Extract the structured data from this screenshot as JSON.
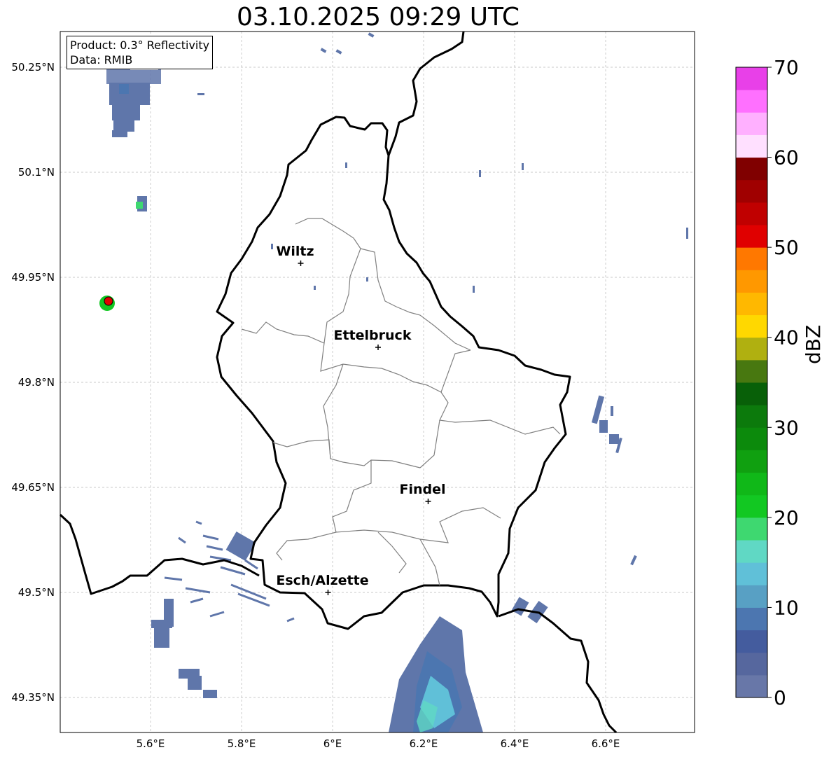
{
  "title": "03.10.2025 09:29 UTC",
  "info": {
    "product": "Product: 0.3° Reflectivity",
    "source": "Data: RMIB"
  },
  "lat_ticks": [
    "50.25°N",
    "50.1°N",
    "49.95°N",
    "49.8°N",
    "49.65°N",
    "49.5°N",
    "49.35°N"
  ],
  "lon_ticks": [
    "5.6°E",
    "5.8°E",
    "6°E",
    "6.2°E",
    "6.4°E",
    "6.6°E"
  ],
  "cities": [
    {
      "name": "Wiltz",
      "lon": 5.93,
      "lat": 49.97
    },
    {
      "name": "Ettelbruck",
      "lon": 6.1,
      "lat": 49.85
    },
    {
      "name": "Findel",
      "lon": 6.21,
      "lat": 49.63
    },
    {
      "name": "Esch/Alzette",
      "lon": 5.99,
      "lat": 49.5
    }
  ],
  "colorbar": {
    "label": "dBZ",
    "ticks": [
      "0",
      "10",
      "20",
      "30",
      "40",
      "50",
      "60",
      "70"
    ],
    "colors": [
      "#6877a8",
      "#56679e",
      "#445c9e",
      "#4c76b0",
      "#58a0c4",
      "#60c0d8",
      "#60d8c4",
      "#3ed870",
      "#12c822",
      "#10b818",
      "#10a010",
      "#0c8a0c",
      "#0c7a0c",
      "#086008",
      "#487810",
      "#b0b010",
      "#ffd800",
      "#ffb800",
      "#ff9800",
      "#ff7800",
      "#e00000",
      "#c00000",
      "#a00000",
      "#800000",
      "#ffe0ff",
      "#ffb0ff",
      "#ff70ff",
      "#e840e8"
    ]
  }
}
